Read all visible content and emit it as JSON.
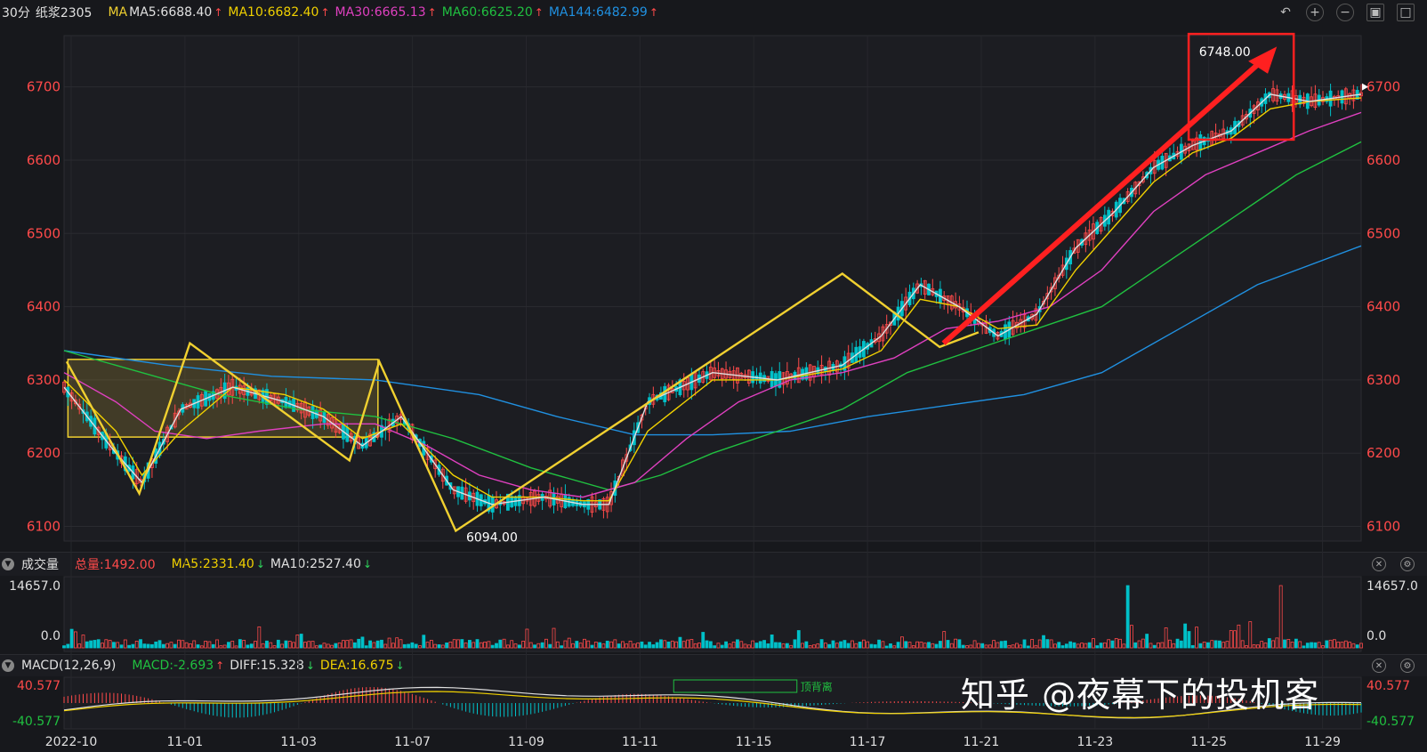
{
  "header": {
    "period": "30分",
    "symbol": "纸浆2305",
    "ma_label": "MA",
    "ma5": "MA5:6688.40",
    "ma10": "MA10:6682.40",
    "ma30": "MA30:6665.13",
    "ma60": "MA60:6625.20",
    "ma144": "MA144:6482.99"
  },
  "volume_header": {
    "title": "成交量",
    "total": "总量:1492.00",
    "ma5": "MA5:2331.40",
    "ma10": "MA10:2527.40"
  },
  "macd_header": {
    "title": "MACD(12,26,9)",
    "macd": "MACD:-2.693",
    "diff": "DIFF:15.328",
    "dea": "DEA:16.675"
  },
  "watermark": "知乎 @夜幕下的投机客",
  "colors": {
    "ma5": "#e0e0e0",
    "ma10": "#f0d000",
    "ma30": "#e040c0",
    "ma60": "#20c040",
    "ma144": "#2090e0",
    "up": "#ff4a4a",
    "down": "#00c0c8",
    "annotation": "#f0d030",
    "highlight": "#ff2020"
  },
  "chart_data": [
    {
      "type": "candlestick",
      "title": "30分 纸浆2305",
      "price_axis": {
        "ticks": [
          "6700",
          "6600",
          "6500",
          "6400",
          "6300",
          "6200",
          "6100"
        ],
        "ylim": [
          6080,
          6770
        ]
      },
      "x_tick_labels": [
        "2022-10",
        "11-01",
        "11-03",
        "11-07",
        "11-09",
        "11-11",
        "11-15",
        "11-17",
        "11-21",
        "11-23",
        "11-25",
        "11-29"
      ],
      "price_annotations": {
        "high": "6748.00",
        "low": "6094.00"
      },
      "series": [
        {
          "name": "MA5",
          "value": 6688.4
        },
        {
          "name": "MA10",
          "value": 6682.4
        },
        {
          "name": "MA30",
          "value": 6665.13
        },
        {
          "name": "MA60",
          "value": 6625.2
        },
        {
          "name": "MA144",
          "value": 6482.99
        }
      ],
      "ma_paths": {
        "ma5": [
          [
            0,
            6290
          ],
          [
            0.04,
            6200
          ],
          [
            0.06,
            6160
          ],
          [
            0.09,
            6260
          ],
          [
            0.13,
            6290
          ],
          [
            0.17,
            6270
          ],
          [
            0.2,
            6250
          ],
          [
            0.23,
            6210
          ],
          [
            0.26,
            6250
          ],
          [
            0.3,
            6150
          ],
          [
            0.33,
            6130
          ],
          [
            0.37,
            6140
          ],
          [
            0.4,
            6130
          ],
          [
            0.42,
            6130
          ],
          [
            0.45,
            6270
          ],
          [
            0.5,
            6310
          ],
          [
            0.55,
            6300
          ],
          [
            0.6,
            6320
          ],
          [
            0.63,
            6360
          ],
          [
            0.66,
            6430
          ],
          [
            0.69,
            6400
          ],
          [
            0.72,
            6360
          ],
          [
            0.75,
            6390
          ],
          [
            0.78,
            6480
          ],
          [
            0.81,
            6530
          ],
          [
            0.84,
            6590
          ],
          [
            0.87,
            6620
          ],
          [
            0.9,
            6640
          ],
          [
            0.93,
            6690
          ],
          [
            0.96,
            6680
          ],
          [
            1,
            6690
          ]
        ],
        "ma10": [
          [
            0,
            6300
          ],
          [
            0.04,
            6230
          ],
          [
            0.06,
            6170
          ],
          [
            0.09,
            6230
          ],
          [
            0.13,
            6290
          ],
          [
            0.17,
            6280
          ],
          [
            0.2,
            6260
          ],
          [
            0.23,
            6220
          ],
          [
            0.26,
            6240
          ],
          [
            0.3,
            6170
          ],
          [
            0.33,
            6140
          ],
          [
            0.37,
            6140
          ],
          [
            0.4,
            6135
          ],
          [
            0.42,
            6135
          ],
          [
            0.45,
            6230
          ],
          [
            0.5,
            6300
          ],
          [
            0.55,
            6300
          ],
          [
            0.6,
            6315
          ],
          [
            0.63,
            6340
          ],
          [
            0.66,
            6410
          ],
          [
            0.69,
            6400
          ],
          [
            0.72,
            6370
          ],
          [
            0.75,
            6375
          ],
          [
            0.78,
            6450
          ],
          [
            0.81,
            6510
          ],
          [
            0.84,
            6570
          ],
          [
            0.87,
            6610
          ],
          [
            0.9,
            6630
          ],
          [
            0.93,
            6670
          ],
          [
            0.96,
            6680
          ],
          [
            1,
            6685
          ]
        ],
        "ma30": [
          [
            0,
            6310
          ],
          [
            0.04,
            6270
          ],
          [
            0.07,
            6230
          ],
          [
            0.11,
            6220
          ],
          [
            0.15,
            6230
          ],
          [
            0.2,
            6240
          ],
          [
            0.24,
            6240
          ],
          [
            0.28,
            6210
          ],
          [
            0.32,
            6170
          ],
          [
            0.36,
            6150
          ],
          [
            0.4,
            6140
          ],
          [
            0.44,
            6160
          ],
          [
            0.48,
            6220
          ],
          [
            0.52,
            6270
          ],
          [
            0.56,
            6300
          ],
          [
            0.6,
            6310
          ],
          [
            0.64,
            6330
          ],
          [
            0.68,
            6370
          ],
          [
            0.72,
            6380
          ],
          [
            0.76,
            6400
          ],
          [
            0.8,
            6450
          ],
          [
            0.84,
            6530
          ],
          [
            0.88,
            6580
          ],
          [
            0.92,
            6610
          ],
          [
            0.96,
            6640
          ],
          [
            1,
            6665
          ]
        ],
        "ma60": [
          [
            0,
            6340
          ],
          [
            0.06,
            6310
          ],
          [
            0.12,
            6280
          ],
          [
            0.18,
            6260
          ],
          [
            0.24,
            6250
          ],
          [
            0.3,
            6220
          ],
          [
            0.36,
            6180
          ],
          [
            0.42,
            6150
          ],
          [
            0.46,
            6170
          ],
          [
            0.5,
            6200
          ],
          [
            0.55,
            6230
          ],
          [
            0.6,
            6260
          ],
          [
            0.65,
            6310
          ],
          [
            0.7,
            6340
          ],
          [
            0.75,
            6370
          ],
          [
            0.8,
            6400
          ],
          [
            0.85,
            6460
          ],
          [
            0.9,
            6520
          ],
          [
            0.95,
            6580
          ],
          [
            1,
            6625
          ]
        ],
        "ma144": [
          [
            0,
            6340
          ],
          [
            0.08,
            6320
          ],
          [
            0.16,
            6305
          ],
          [
            0.24,
            6300
          ],
          [
            0.32,
            6280
          ],
          [
            0.38,
            6250
          ],
          [
            0.44,
            6225
          ],
          [
            0.5,
            6225
          ],
          [
            0.56,
            6230
          ],
          [
            0.62,
            6250
          ],
          [
            0.68,
            6265
          ],
          [
            0.74,
            6280
          ],
          [
            0.8,
            6310
          ],
          [
            0.86,
            6370
          ],
          [
            0.92,
            6430
          ],
          [
            1,
            6483
          ]
        ]
      }
    },
    {
      "type": "bar",
      "title": "成交量",
      "axis_ticks": [
        "14657.0",
        "0.0"
      ],
      "ylim": [
        0,
        14657
      ]
    },
    {
      "type": "bar",
      "title": "MACD(12,26,9)",
      "axis_ticks": [
        "40.577",
        "-40.577"
      ],
      "ylim": [
        -40.577,
        40.577
      ],
      "annotation": "顶背离"
    }
  ]
}
